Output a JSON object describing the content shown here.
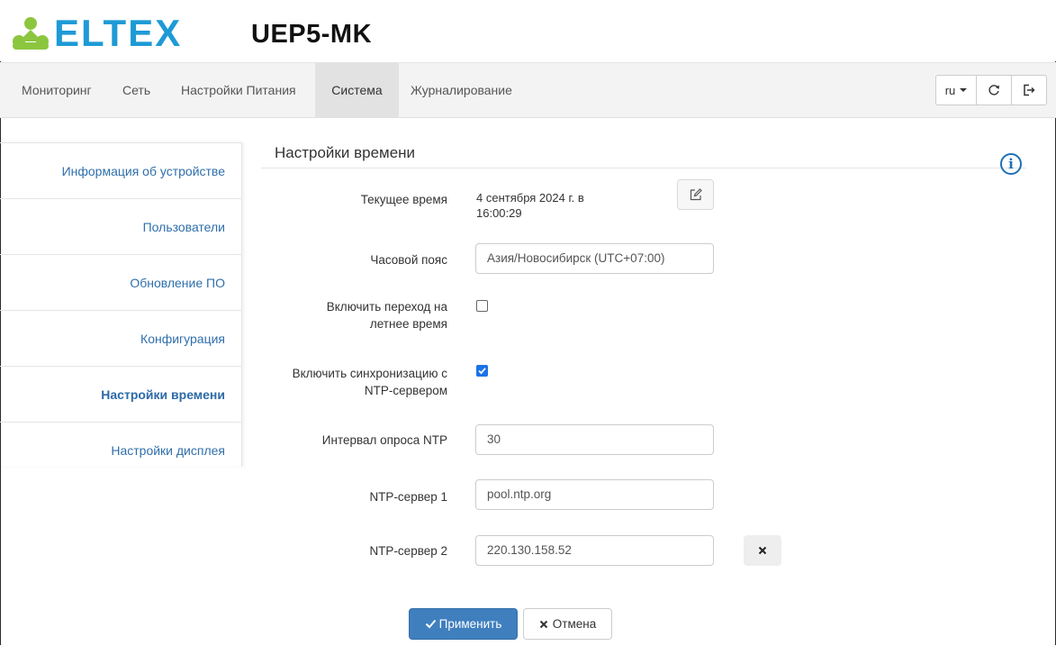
{
  "header": {
    "logo_text": "ELTEX",
    "device_title": "UEP5-MK"
  },
  "nav": {
    "items": [
      {
        "label": "Мониторинг"
      },
      {
        "label": "Сеть"
      },
      {
        "label": "Настройки Питания"
      },
      {
        "label": "Система",
        "active": true
      },
      {
        "label": "Журналирование"
      }
    ],
    "language": "ru",
    "refresh_icon": "refresh-icon",
    "logout_icon": "logout-icon"
  },
  "sidebar": {
    "items": [
      {
        "label": "Информация об устройстве"
      },
      {
        "label": "Пользователи"
      },
      {
        "label": "Обновление ПО"
      },
      {
        "label": "Конфигурация"
      },
      {
        "label": "Настройки времени",
        "active": true
      },
      {
        "label": "Настройки дисплея"
      }
    ]
  },
  "content": {
    "section_title": "Настройки времени",
    "current_time": {
      "label": "Текущее время",
      "value_line1": "4 сентября 2024 г. в",
      "value_line2": "16:00:29"
    },
    "timezone": {
      "label": "Часовой пояс",
      "value": "Азия/Новосибирск (UTC+07:00)"
    },
    "dst": {
      "label_line1": "Включить переход на",
      "label_line2": "летнее время",
      "checked": false
    },
    "ntp_sync": {
      "label_line1": "Включить синхронизацию с",
      "label_line2": "NTP-сервером",
      "checked": true
    },
    "ntp_interval": {
      "label": "Интервал опроса NTP",
      "value": "30"
    },
    "ntp_server1": {
      "label": "NTP-сервер 1",
      "value": "pool.ntp.org"
    },
    "ntp_server2": {
      "label": "NTP-сервер 2",
      "value": "220.130.158.52"
    }
  },
  "actions": {
    "apply_label": "Применить",
    "cancel_label": "Отмена"
  },
  "colors": {
    "brand_blue": "#1e9ad6",
    "logo_green": "#8cc63f",
    "link_blue": "#2f6fab",
    "apply_blue": "#3f7fbe",
    "checkbox_blue": "#1a73e8"
  }
}
